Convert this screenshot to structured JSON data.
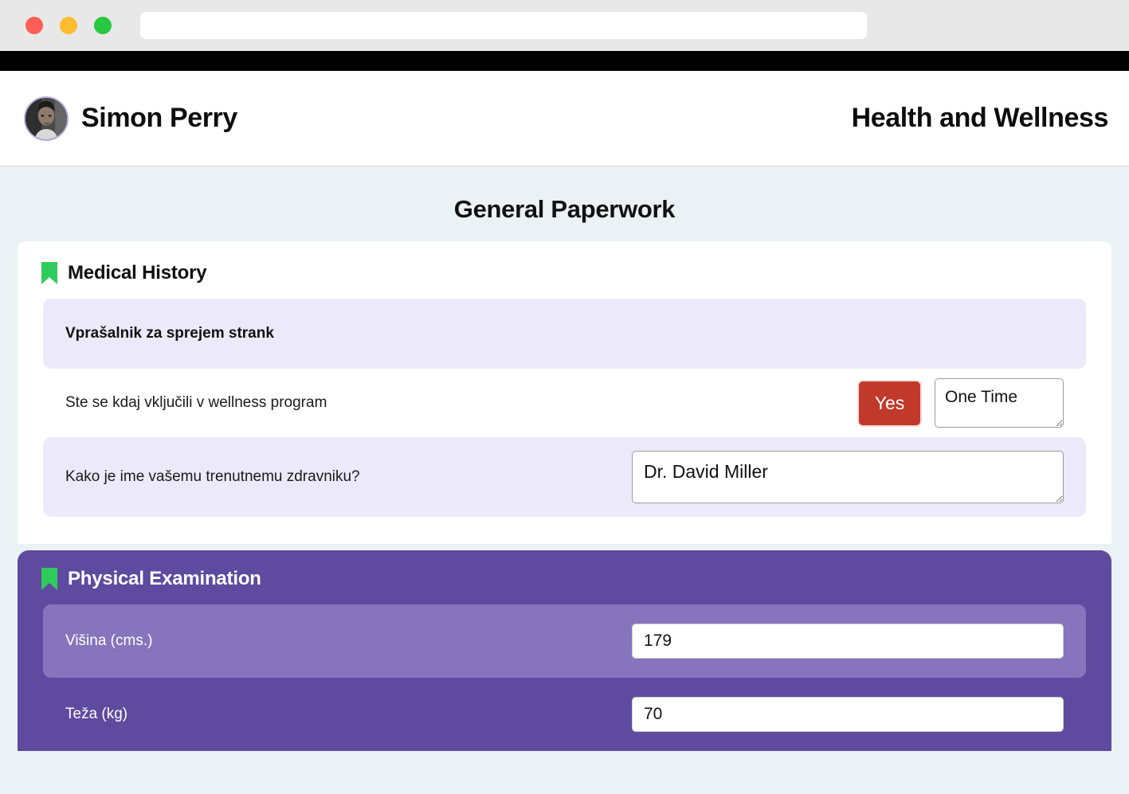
{
  "browser": {
    "url_value": "",
    "url_placeholder": "",
    "traffic_lights": [
      "close",
      "minimize",
      "maximize"
    ]
  },
  "header": {
    "user_name": "Simon Perry",
    "app_title": "Health and Wellness",
    "avatar_alt": "Simon Perry portrait"
  },
  "page": {
    "title": "General Paperwork",
    "background_color": "#eaf2f5"
  },
  "sections": [
    {
      "id": "medical-history",
      "title": "Medical History",
      "icon": "bookmark-icon",
      "icon_color": "#2ecc5b",
      "theme": "white",
      "banner": {
        "label": "Vprašalnik za sprejem strank"
      },
      "rows": [
        {
          "label": "Ste se kdaj vključili v wellness program",
          "button_label": "Yes",
          "button_color": "#c0392b",
          "textarea_value": "One Time",
          "textarea_placeholder": ""
        },
        {
          "label": "Kako je ime vašemu trenutnemu zdravniku?",
          "textarea_value": "Dr. David Miller",
          "textarea_placeholder": ""
        }
      ]
    },
    {
      "id": "physical-examination",
      "title": "Physical Examination",
      "icon": "bookmark-icon",
      "icon_color": "#2ecc5b",
      "theme": "purple",
      "background_color": "#5e4a9e",
      "rows": [
        {
          "label": "Višina (cms.)",
          "value": "179",
          "placeholder": ""
        },
        {
          "label": "Teža (kg)",
          "value": "70",
          "placeholder": ""
        }
      ]
    }
  ]
}
